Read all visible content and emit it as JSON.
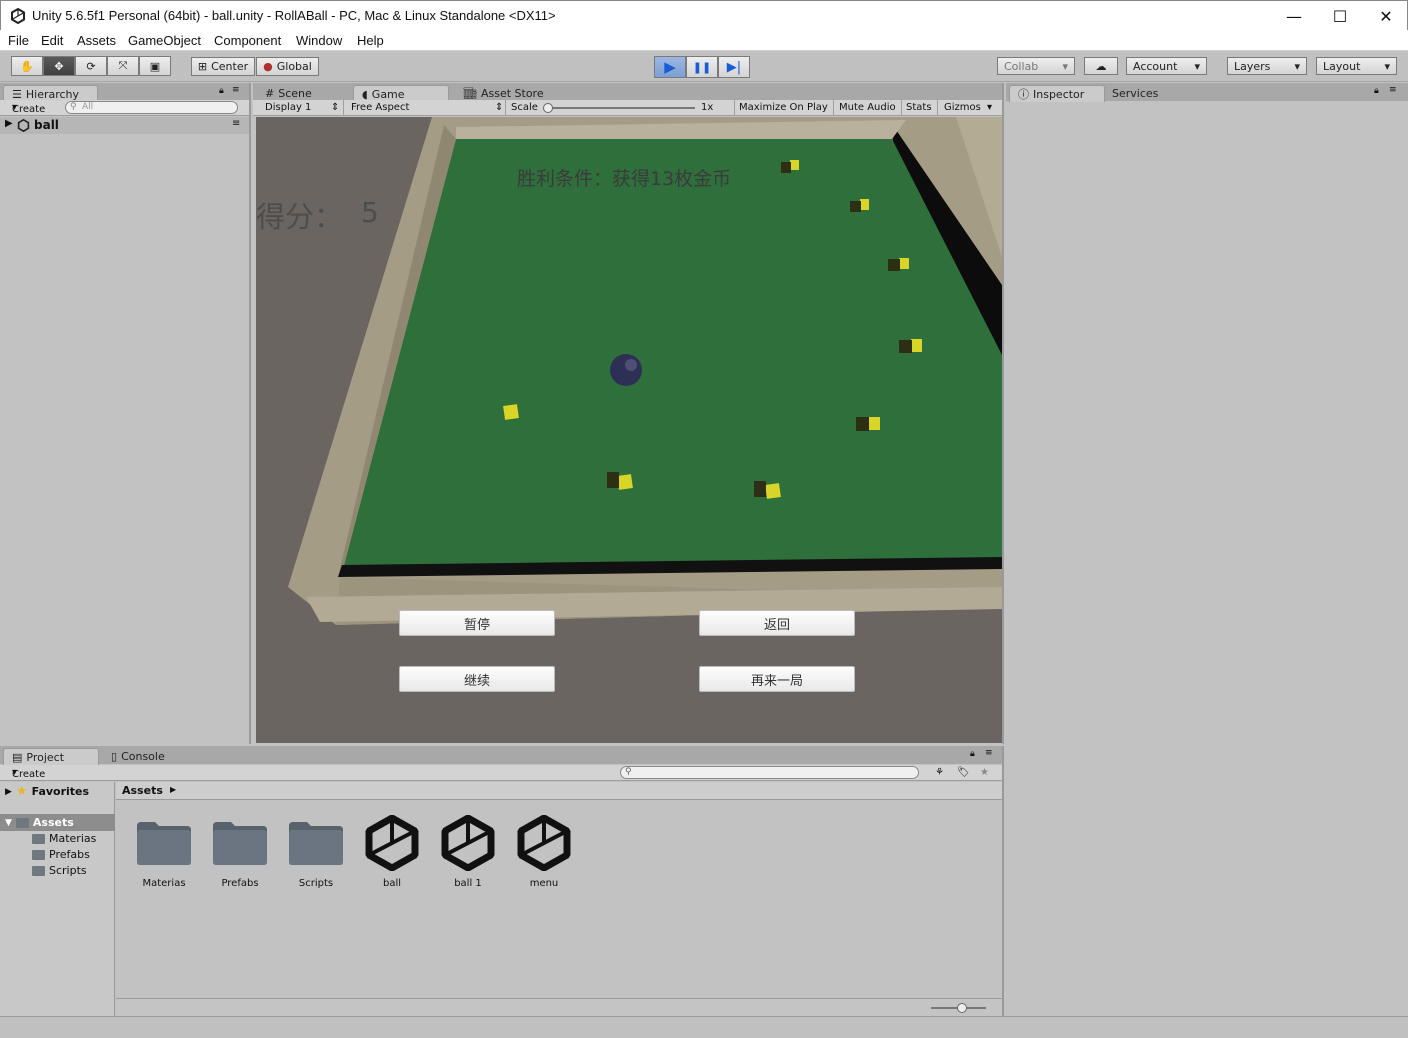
{
  "window": {
    "title": "Unity 5.6.5f1 Personal (64bit) - ball.unity - RollABall - PC, Mac & Linux Standalone <DX11>"
  },
  "menu": [
    "File",
    "Edit",
    "Assets",
    "GameObject",
    "Component",
    "Window",
    "Help"
  ],
  "toolbar": {
    "center": "Center",
    "global": "Global",
    "collab": "Collab",
    "account": "Account",
    "layers": "Layers",
    "layout": "Layout"
  },
  "hierarchy": {
    "tab": "Hierarchy",
    "create": "Create",
    "search_placeholder": "All",
    "root_item": "ball"
  },
  "tabs": {
    "scene": "Scene",
    "game": "Game",
    "asset_store": "Asset Store",
    "inspector": "Inspector",
    "services": "Services",
    "project": "Project",
    "console": "Console"
  },
  "game_bar": {
    "display": "Display 1",
    "aspect": "Free Aspect",
    "scale_label": "Scale",
    "scale_value": "1x",
    "maximize": "Maximize On Play",
    "mute": "Mute Audio",
    "stats": "Stats",
    "gizmos": "Gizmos"
  },
  "game": {
    "win_condition": "胜利条件：获得13枚金币",
    "score_label": "得分：",
    "score_value": "5",
    "pause": "暂停",
    "back": "返回",
    "continue": "继续",
    "restart": "再来一局"
  },
  "project": {
    "create": "Create",
    "favorites": "Favorites",
    "assets_root": "Assets",
    "tree": [
      "Materias",
      "Prefabs",
      "Scripts"
    ],
    "breadcrumb": "Assets",
    "items": [
      {
        "name": "Materias",
        "type": "folder"
      },
      {
        "name": "Prefabs",
        "type": "folder"
      },
      {
        "name": "Scripts",
        "type": "folder"
      },
      {
        "name": "ball",
        "type": "scene"
      },
      {
        "name": "ball 1",
        "type": "scene"
      },
      {
        "name": "menu",
        "type": "scene"
      }
    ]
  }
}
